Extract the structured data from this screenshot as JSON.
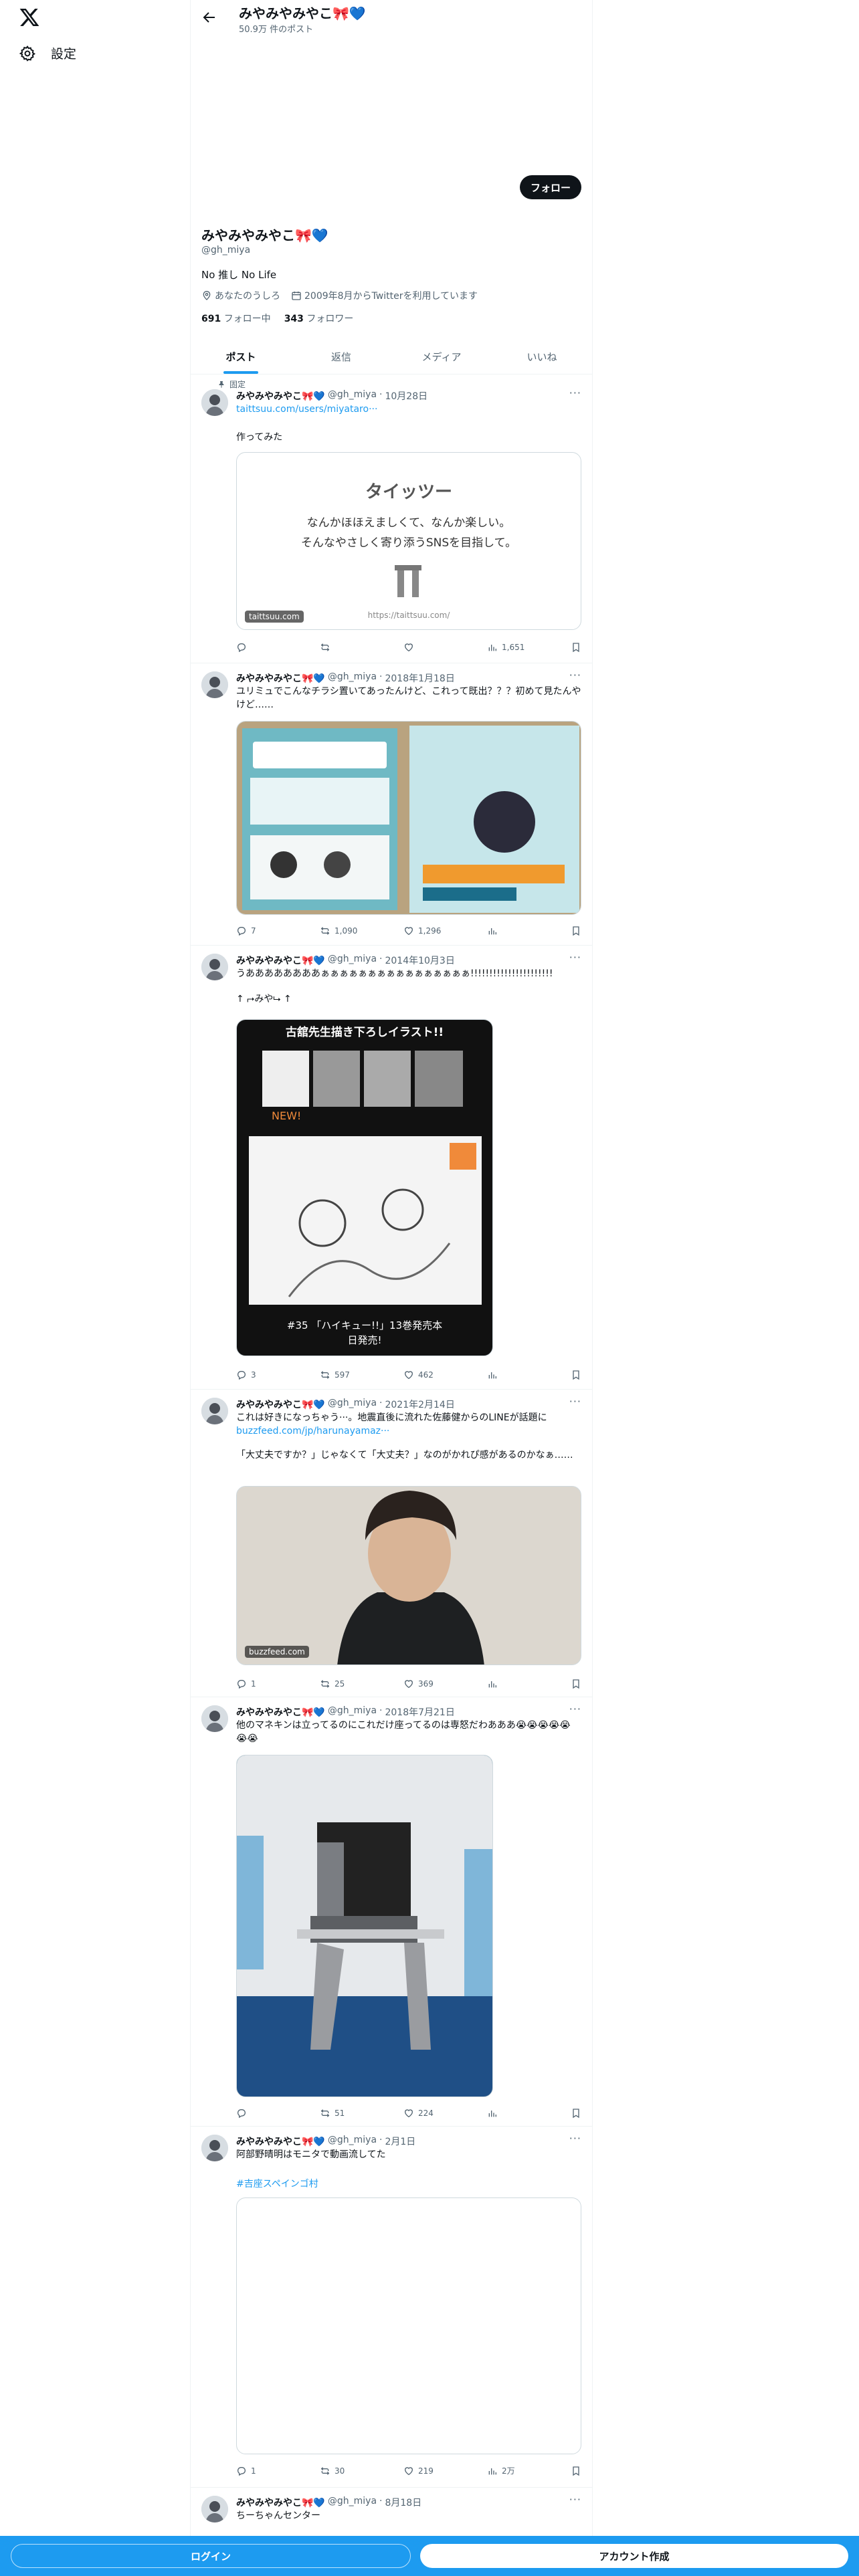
{
  "app": {
    "settings_label": "設定"
  },
  "header": {
    "name": "みやみやみやこ🎀💙",
    "post_count": "50.9万 件のポスト"
  },
  "profile": {
    "follow_label": "フォロー",
    "name": "みやみやみやこ🎀💙",
    "handle": "@gh_miya",
    "bio": "No 推し No Life",
    "location": "あなたのうしろ",
    "joined": "2009年8月からTwitterを利用しています",
    "following_count": "691",
    "following_label": "フォロー中",
    "followers_count": "343",
    "followers_label": "フォロワー"
  },
  "tabs": [
    "ポスト",
    "返信",
    "メディア",
    "いいね"
  ],
  "posts": [
    {
      "pinned_label": "固定",
      "name": "みやみやみやこ🎀💙",
      "handle": "@gh_miya",
      "date": "10月28日",
      "link": "taittsuu.com/users/miyataro···",
      "text": "作ってみた",
      "card": {
        "title": "タイッツー",
        "line1": "なんかほほえましくて、なんか楽しい。",
        "line2": "そんなやさしく寄り添うSNSを目指して。",
        "url": "https://taittsuu.com/",
        "domain": "taittsuu.com"
      },
      "replies": "",
      "reposts": "",
      "likes": "",
      "views": "1,651"
    },
    {
      "name": "みやみやみやこ🎀💙",
      "handle": "@gh_miya",
      "date": "2018年1月18日",
      "text": "ユリミュでこんなチラシ置いてあったんけど、これって既出？？？初めて見たんやけど……",
      "replies": "7",
      "reposts": "1,090",
      "likes": "1,296",
      "views": ""
    },
    {
      "name": "みやみやみやこ🎀💙",
      "handle": "@gh_miya",
      "date": "2014年10月3日",
      "text": "うああああああああぁぁぁぁぁぁぁぁぁぁぁぁぁぁぁぁ!!!!!!!!!!!!!!!!!!!!!!",
      "text2": "↑ ⮣みや⮡ ↑",
      "image": {
        "heading": "古舘先生描き下ろしイラスト!!",
        "new": "NEW!",
        "caption1": "#35 「ハイキュー!!」13巻発売本",
        "caption2": "日発売!"
      },
      "replies": "3",
      "reposts": "597",
      "likes": "462",
      "views": ""
    },
    {
      "name": "みやみやみやこ🎀💙",
      "handle": "@gh_miya",
      "date": "2021年2月14日",
      "text": "これは好きになっちゃう···。地震直後に流れた佐藤健からのLINEが話題に",
      "link": "buzzfeed.com/jp/harunayamaz···",
      "text2": "「大丈夫ですか？」じゃなくて「大丈夫？」なのがかれぴ感があるのかなぁ……",
      "domain": "buzzfeed.com",
      "replies": "1",
      "reposts": "25",
      "likes": "369",
      "views": ""
    },
    {
      "name": "みやみやみやこ🎀💙",
      "handle": "@gh_miya",
      "date": "2018年7月21日",
      "text": "他のマネキンは立ってるのにこれだけ座ってるのは専怒だわあああ😭😭😭😭😭😭😭",
      "replies": "",
      "reposts": "51",
      "likes": "224",
      "views": ""
    },
    {
      "name": "みやみやみやこ🎀💙",
      "handle": "@gh_miya",
      "date": "2月1日",
      "text": "阿部野晴明はモニタで動画流してた",
      "hashtag": "#吉座スペインゴ村",
      "replies": "1",
      "reposts": "30",
      "likes": "219",
      "views": "2万"
    },
    {
      "name": "みやみやみやこ🎀💙",
      "handle": "@gh_miya",
      "date": "8月18日",
      "text": "ちーちゃんセンター"
    }
  ],
  "bottom": {
    "login_label": "ログイン",
    "signup_label": "アカウント作成"
  },
  "colors": {
    "accent": "#1d9bf0",
    "text": "#0f1419",
    "muted": "#536471",
    "border": "#eff3f4"
  }
}
